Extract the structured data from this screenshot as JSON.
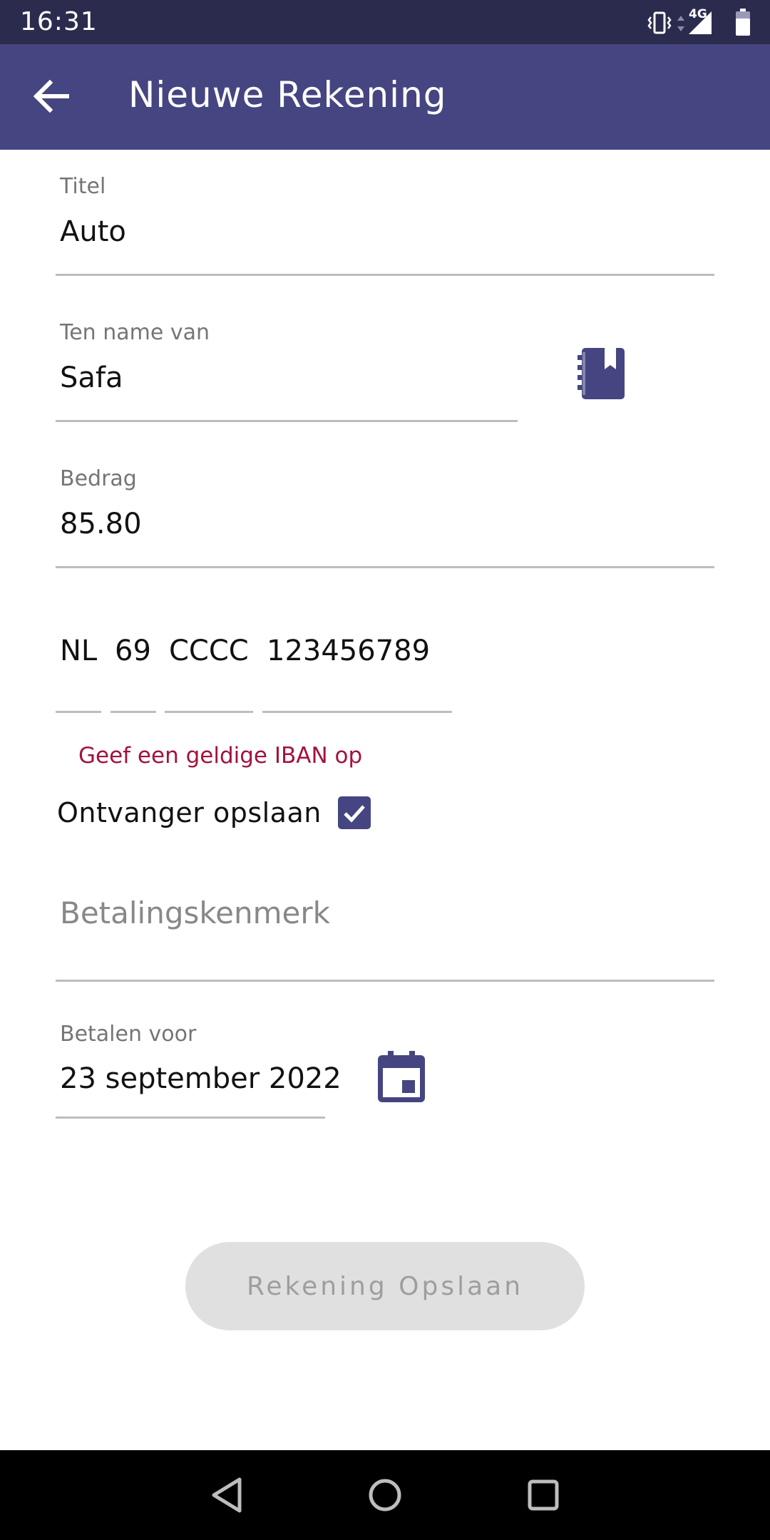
{
  "status_bar": {
    "time": "16:31",
    "network": "4G",
    "icons": [
      "vibrate-icon",
      "network-arrows-icon",
      "signal-icon",
      "battery-icon"
    ]
  },
  "app_bar": {
    "back_icon": "arrow-left-icon",
    "title": "Nieuwe Rekening"
  },
  "form": {
    "titel": {
      "label": "Titel",
      "value": "Auto"
    },
    "ten_name_van": {
      "label": "Ten name van",
      "value": "Safa",
      "contacts_icon": "contacts-book-icon"
    },
    "bedrag": {
      "label": "Bedrag",
      "value": "85.80"
    },
    "iban": {
      "country": "NL",
      "check": "69",
      "bank": "CCCC",
      "account": "123456789",
      "error": "Geef een geldige IBAN op"
    },
    "ontvanger_opslaan": {
      "label": "Ontvanger opslaan",
      "checked": true
    },
    "betalingskenmerk": {
      "placeholder": "Betalingskenmerk"
    },
    "betalen_voor": {
      "label": "Betalen voor",
      "value": "23 september 2022",
      "calendar_icon": "calendar-icon"
    }
  },
  "save_button": {
    "label": "Rekening Opslaan",
    "enabled": false
  },
  "nav_bar": {
    "icons": [
      "back-triangle-icon",
      "home-circle-icon",
      "recents-square-icon"
    ]
  },
  "colors": {
    "status_bar": "#2b2c4d",
    "app_bar": "#454581",
    "accent": "#454581",
    "error": "#a3123d",
    "button_disabled": "#e0e0e0"
  }
}
